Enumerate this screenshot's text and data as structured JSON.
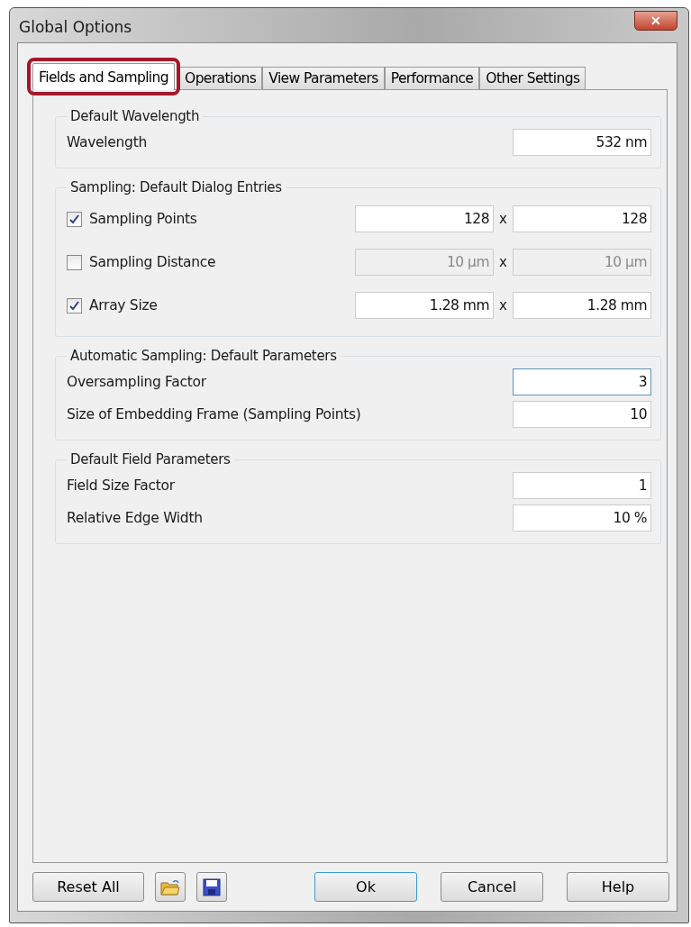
{
  "window": {
    "title": "Global Options",
    "close": "✕"
  },
  "tabs": [
    {
      "label": "Fields and Sampling",
      "selected": true,
      "highlighted": true
    },
    {
      "label": "Operations",
      "selected": false,
      "highlighted": false
    },
    {
      "label": "View Parameters",
      "selected": false,
      "highlighted": false
    },
    {
      "label": "Performance",
      "selected": false,
      "highlighted": false
    },
    {
      "label": "Other Settings",
      "selected": false,
      "highlighted": false
    }
  ],
  "groups": [
    {
      "title": "Default Wavelength",
      "rows": [
        {
          "kind": "field",
          "label": "Wavelength",
          "value": "532 nm",
          "focused": false
        }
      ]
    },
    {
      "title": "Sampling: Default Dialog Entries",
      "rows": [
        {
          "kind": "pair",
          "label": "Sampling Points",
          "checked": true,
          "values": [
            "128",
            "128"
          ],
          "separator": "x"
        },
        {
          "kind": "pair",
          "label": "Sampling Distance",
          "checked": false,
          "values": [
            "10 µm",
            "10 µm"
          ],
          "separator": "x"
        },
        {
          "kind": "pair",
          "label": "Array Size",
          "checked": true,
          "values": [
            "1.28 mm",
            "1.28 mm"
          ],
          "separator": "x"
        }
      ]
    },
    {
      "title": "Automatic Sampling: Default Parameters",
      "rows": [
        {
          "kind": "field",
          "label": "Oversampling Factor",
          "value": "3",
          "focused": true
        },
        {
          "kind": "field",
          "label": "Size of Embedding Frame (Sampling Points)",
          "value": "10",
          "focused": false
        }
      ]
    },
    {
      "title": "Default Field Parameters",
      "rows": [
        {
          "kind": "field",
          "label": "Field Size Factor",
          "value": "1",
          "focused": false
        },
        {
          "kind": "field",
          "label": "Relative Edge Width",
          "value": "10 %",
          "focused": false
        }
      ]
    }
  ],
  "footer": {
    "left": [
      {
        "kind": "text",
        "label": "Reset All"
      },
      {
        "kind": "open"
      },
      {
        "kind": "save"
      }
    ],
    "right": [
      {
        "label": "Ok",
        "default": true
      },
      {
        "label": "Cancel",
        "default": false
      },
      {
        "label": "Help",
        "default": false
      }
    ]
  }
}
